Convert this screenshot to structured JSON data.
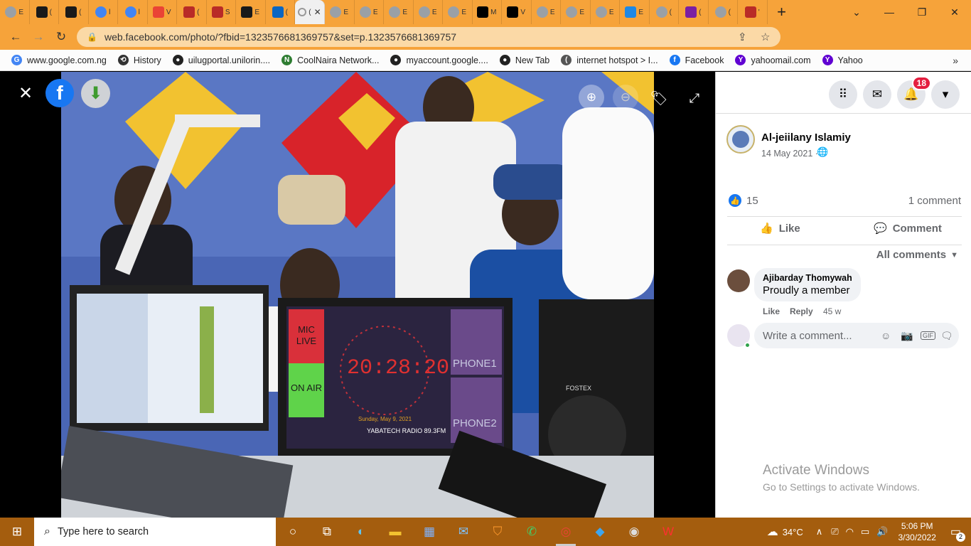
{
  "browser": {
    "tabs": [
      {
        "icon": "chrome-icon",
        "color": "#9aa0a6",
        "label": "E"
      },
      {
        "icon": "doc-icon",
        "color": "#1a1a1a",
        "label": "("
      },
      {
        "icon": "doc-icon",
        "color": "#1a1a1a",
        "label": "("
      },
      {
        "icon": "google-icon",
        "color": "#4285f4",
        "label": "l"
      },
      {
        "icon": "google-icon",
        "color": "#4285f4",
        "label": "l"
      },
      {
        "icon": "gmail-icon",
        "color": "#ea4335",
        "label": "V"
      },
      {
        "icon": "quora-icon",
        "color": "#b92b27",
        "label": "("
      },
      {
        "icon": "quora-icon",
        "color": "#b92b27",
        "label": "S"
      },
      {
        "icon": "doc-icon",
        "color": "#1a1a1a",
        "label": "E"
      },
      {
        "icon": "linkedin-icon",
        "color": "#0a66c2",
        "label": "("
      },
      {
        "icon": "active-tab",
        "color": "#f0f0f0",
        "label": "("
      },
      {
        "icon": "chrome-icon",
        "color": "#9aa0a6",
        "label": "E"
      },
      {
        "icon": "chrome-icon",
        "color": "#9aa0a6",
        "label": "E"
      },
      {
        "icon": "chrome-icon",
        "color": "#9aa0a6",
        "label": "E"
      },
      {
        "icon": "chrome-icon",
        "color": "#9aa0a6",
        "label": "E"
      },
      {
        "icon": "chrome-icon",
        "color": "#9aa0a6",
        "label": "E"
      },
      {
        "icon": "medium-icon",
        "color": "#000000",
        "label": "M"
      },
      {
        "icon": "b-icon",
        "color": "#000000",
        "label": "V"
      },
      {
        "icon": "chrome-icon",
        "color": "#9aa0a6",
        "label": "E"
      },
      {
        "icon": "chrome-icon",
        "color": "#9aa0a6",
        "label": "E"
      },
      {
        "icon": "chrome-icon",
        "color": "#9aa0a6",
        "label": "E"
      },
      {
        "icon": "s-icon",
        "color": "#1e88e5",
        "label": "E"
      },
      {
        "icon": "chrome-icon",
        "color": "#9aa0a6",
        "label": "("
      },
      {
        "icon": "b-purple-icon",
        "color": "#7b1fa2",
        "label": "("
      },
      {
        "icon": "chrome-icon",
        "color": "#9aa0a6",
        "label": "("
      },
      {
        "icon": "quora-icon",
        "color": "#b92b27",
        "label": "'"
      }
    ],
    "url": "web.facebook.com/photo/?fbid=1323576681369757&set=p.1323576681369757",
    "bookmarks": [
      {
        "label": "www.google.com.ng",
        "icon": "google-icon",
        "color": "#4285f4",
        "glyph": "G"
      },
      {
        "label": "History",
        "icon": "history-icon",
        "color": "#333333",
        "glyph": "⟲"
      },
      {
        "label": "uilugportal.unilorin....",
        "icon": "globe-icon",
        "color": "#222222",
        "glyph": "●"
      },
      {
        "label": "CoolNaira Network...",
        "icon": "coolnaira-icon",
        "color": "#2e7d32",
        "glyph": "N"
      },
      {
        "label": "myaccount.google....",
        "icon": "globe-icon",
        "color": "#222222",
        "glyph": "●"
      },
      {
        "label": "New Tab",
        "icon": "globe-icon",
        "color": "#222222",
        "glyph": "●"
      },
      {
        "label": "internet hotspot > I...",
        "icon": "hotspot-icon",
        "color": "#555555",
        "glyph": "("
      },
      {
        "label": "Facebook",
        "icon": "facebook-icon",
        "color": "#1877f2",
        "glyph": "f"
      },
      {
        "label": "yahoomail.com",
        "icon": "yahoo-icon",
        "color": "#6001d2",
        "glyph": "Y"
      },
      {
        "label": "Yahoo",
        "icon": "yahoo-icon",
        "color": "#6001d2",
        "glyph": "Y"
      }
    ]
  },
  "photo_overlay": {
    "mic_live": "MIC LIVE",
    "on_air": "ON AIR",
    "clock": "20:28:20",
    "date": "Sunday, May 9, 2021",
    "station": "YABATECH RADIO 89.3FM",
    "phone1": "PHONE1",
    "phone2": "PHONE2",
    "speaker_brand": "FOSTEX"
  },
  "post": {
    "author": "Al-jeiilany Islamiy",
    "date": "14 May 2021 ·",
    "likes": "15",
    "comments_count": "1 comment",
    "like_label": "Like",
    "comment_label": "Comment",
    "filter_label": "All comments",
    "notifications": "18"
  },
  "comment": {
    "author": "Ajibarday Thomywah",
    "text": "Proudly a member",
    "like": "Like",
    "reply": "Reply",
    "age": "45 w"
  },
  "composer": {
    "placeholder": "Write a comment..."
  },
  "watermark": {
    "title": "Activate Windows",
    "subtitle": "Go to Settings to activate Windows."
  },
  "taskbar": {
    "search_placeholder": "Type here to search",
    "weather": "34°C",
    "time": "5:06 PM",
    "date": "3/30/2022",
    "notif_count": "2"
  },
  "colors": {
    "browser_frame": "#f6a33a",
    "facebook_blue": "#1877f2",
    "taskbar": "#a45d0e"
  }
}
